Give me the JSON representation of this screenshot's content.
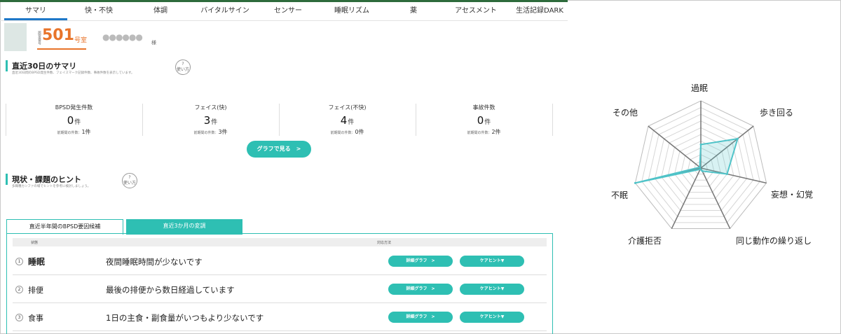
{
  "tabs": [
    {
      "label": "サマリ",
      "active": true
    },
    {
      "label": "快・不快",
      "active": false
    },
    {
      "label": "体調",
      "active": false
    },
    {
      "label": "バイタルサイン",
      "active": false
    },
    {
      "label": "センサー",
      "active": false
    },
    {
      "label": "睡眠リズム",
      "active": false
    },
    {
      "label": "薬",
      "active": false
    },
    {
      "label": "アセスメント",
      "active": false
    },
    {
      "label": "生活記録DARK",
      "active": false
    }
  ],
  "resident": {
    "room_prefix": "居室番号",
    "room_number": "501",
    "room_suffix": "号室",
    "name_masked": "●●●●●●",
    "honorific": "様"
  },
  "summary": {
    "title": "直近30日のサマリ",
    "subtitle": "直近30日間のBPSD発生件数、フェイスマーク記録件数、事故件数を表示しています。",
    "help": "使い方",
    "help_mark": "?",
    "stats": [
      {
        "label": "BPSD発生件数",
        "value": "0",
        "unit": "件",
        "prev_label": "前期間の件数：",
        "prev_value": "1件"
      },
      {
        "label": "フェイス(快)",
        "value": "3",
        "unit": "件",
        "prev_label": "前期間の件数：",
        "prev_value": "3件"
      },
      {
        "label": "フェイス(不快)",
        "value": "4",
        "unit": "件",
        "prev_label": "前期間の件数：",
        "prev_value": "0件"
      },
      {
        "label": "事故件数",
        "value": "0",
        "unit": "件",
        "prev_label": "前期間の件数：",
        "prev_value": "2件"
      }
    ],
    "graph_button": "グラフで見る　>"
  },
  "hints": {
    "title": "現状・課題のヒント",
    "subtitle": "多職種カンファの場でヒントを参考に検討しましょう。",
    "help": "使い方",
    "help_mark": "?",
    "tabs": [
      {
        "label": "直近半年間のBPSD要因候補",
        "active": true
      },
      {
        "label": "直近3か月の変調",
        "active": false
      }
    ],
    "columns": [
      "状態",
      "対応方法"
    ],
    "rows": [
      {
        "num": "1",
        "category": "睡眠",
        "description": "夜間睡眠時間が少ないです",
        "detail_btn": "詳細グラフ　>",
        "hint_btn": "ケアヒント▼"
      },
      {
        "num": "2",
        "category": "排便",
        "description": "最後の排便から数日経過しています",
        "detail_btn": "詳細グラフ　>",
        "hint_btn": "ケアヒント▼"
      },
      {
        "num": "3",
        "category": "食事",
        "description": "1日の主食・副食量がいつもより少ないです",
        "detail_btn": "詳細グラフ　>",
        "hint_btn": "ケアヒント▼"
      }
    ]
  },
  "chart_data": {
    "type": "radar",
    "axes": [
      "過眠",
      "歩き回る",
      "妄想・幻覚",
      "同じ動作の繰り返し",
      "介護拒否",
      "不眠",
      "その他"
    ],
    "series": [
      {
        "values": [
          0.35,
          0.7,
          0.4,
          0.05,
          0.02,
          1.0,
          0.02
        ],
        "color": "#4fc3c8"
      }
    ],
    "rlim": [
      0,
      1
    ],
    "rings": 10
  }
}
